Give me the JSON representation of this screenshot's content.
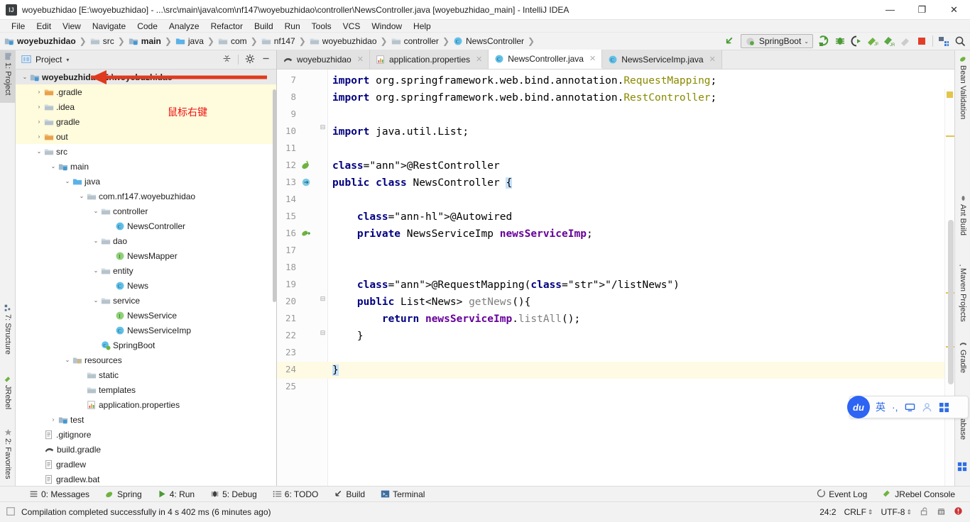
{
  "window": {
    "title": "woyebuzhidao [E:\\woyebuzhidao] - ...\\src\\main\\java\\com\\nf147\\woyebuzhidao\\controller\\NewsController.java [woyebuzhidao_main] - IntelliJ IDEA",
    "app_icon": "IJ",
    "minimize": "—",
    "maximize": "❐",
    "close": "✕"
  },
  "menubar": {
    "items": [
      {
        "label": "File"
      },
      {
        "label": "Edit"
      },
      {
        "label": "View"
      },
      {
        "label": "Navigate"
      },
      {
        "label": "Code"
      },
      {
        "label": "Analyze"
      },
      {
        "label": "Refactor"
      },
      {
        "label": "Build"
      },
      {
        "label": "Run"
      },
      {
        "label": "Tools"
      },
      {
        "label": "VCS"
      },
      {
        "label": "Window"
      },
      {
        "label": "Help"
      }
    ]
  },
  "breadcrumb": {
    "items": [
      {
        "label": "woyebuzhidao",
        "icon": "module-icon",
        "bold": true
      },
      {
        "label": "src",
        "icon": "folder-icon",
        "bold": false
      },
      {
        "label": "main",
        "icon": "module-source-icon",
        "bold": true
      },
      {
        "label": "java",
        "icon": "source-root-icon",
        "bold": false
      },
      {
        "label": "com",
        "icon": "package-icon",
        "bold": false
      },
      {
        "label": "nf147",
        "icon": "package-icon",
        "bold": false
      },
      {
        "label": "woyebuzhidao",
        "icon": "package-icon",
        "bold": false
      },
      {
        "label": "controller",
        "icon": "package-icon",
        "bold": false
      },
      {
        "label": "NewsController",
        "icon": "class-icon",
        "bold": false
      }
    ]
  },
  "toolbar": {
    "back_arrow": "back-arrow-icon",
    "run_config": "SpringBoot",
    "run_config_caret": "⌄",
    "buttons": [
      {
        "name": "run-button",
        "glyph": "▶"
      },
      {
        "name": "debug-button",
        "glyph": "🐞"
      },
      {
        "name": "run-with-coverage-button",
        "glyph": "▷"
      },
      {
        "name": "attach-profiler-button",
        "glyph": "◤"
      },
      {
        "name": "jrebel-debug-button",
        "glyph": "◥"
      },
      {
        "name": "jrebel-run-button",
        "glyph": "◣"
      },
      {
        "name": "stop-button",
        "glyph": "■"
      },
      {
        "name": "project-structure-button",
        "glyph": "▦"
      },
      {
        "name": "search-everywhere-button",
        "glyph": "🔍"
      }
    ]
  },
  "left_strip": {
    "tabs": [
      {
        "label": "1: Project",
        "selected": true
      },
      {
        "label": "7: Structure",
        "selected": false
      },
      {
        "label": "JRebel",
        "selected": false
      },
      {
        "label": "2: Favorites",
        "selected": false
      }
    ]
  },
  "right_strip": {
    "tabs": [
      {
        "label": "Bean Validation"
      },
      {
        "label": "Ant Build"
      },
      {
        "label": "Maven Projects"
      },
      {
        "label": "Gradle"
      },
      {
        "label": "Database"
      }
    ]
  },
  "project_panel": {
    "title": "Project",
    "caret": "▾",
    "collapse_all_icon": "collapse-all-icon",
    "settings_icon": "gear-icon",
    "hide_icon": "minimize-icon",
    "tree": [
      {
        "label": "woyebuzhidao  E:\\woyebuzhidao",
        "depth": 0,
        "twist": "⌄",
        "icon": "module-icon",
        "bold": true,
        "row": "selected"
      },
      {
        "label": ".gradle",
        "depth": 1,
        "twist": "›",
        "icon": "folder-orange-icon",
        "bold": false,
        "row": "yellow"
      },
      {
        "label": ".idea",
        "depth": 1,
        "twist": "›",
        "icon": "folder-icon",
        "bold": false,
        "row": "yellow"
      },
      {
        "label": "gradle",
        "depth": 1,
        "twist": "›",
        "icon": "folder-icon",
        "bold": false,
        "row": "yellow"
      },
      {
        "label": "out",
        "depth": 1,
        "twist": "›",
        "icon": "folder-orange-icon",
        "bold": false,
        "row": "yellow"
      },
      {
        "label": "src",
        "depth": 1,
        "twist": "⌄",
        "icon": "folder-icon",
        "bold": false,
        "row": "none"
      },
      {
        "label": "main",
        "depth": 2,
        "twist": "⌄",
        "icon": "module-source-icon",
        "bold": false,
        "row": "none"
      },
      {
        "label": "java",
        "depth": 3,
        "twist": "⌄",
        "icon": "source-root-icon",
        "bold": false,
        "row": "none"
      },
      {
        "label": "com.nf147.woyebuzhidao",
        "depth": 4,
        "twist": "⌄",
        "icon": "package-icon",
        "bold": false,
        "row": "none"
      },
      {
        "label": "controller",
        "depth": 5,
        "twist": "⌄",
        "icon": "package-icon",
        "bold": false,
        "row": "none"
      },
      {
        "label": "NewsController",
        "depth": 6,
        "twist": "",
        "icon": "class-icon",
        "bold": false,
        "row": "none"
      },
      {
        "label": "dao",
        "depth": 5,
        "twist": "⌄",
        "icon": "package-icon",
        "bold": false,
        "row": "none"
      },
      {
        "label": "NewsMapper",
        "depth": 6,
        "twist": "",
        "icon": "interface-icon",
        "bold": false,
        "row": "none"
      },
      {
        "label": "entity",
        "depth": 5,
        "twist": "⌄",
        "icon": "package-icon",
        "bold": false,
        "row": "none"
      },
      {
        "label": "News",
        "depth": 6,
        "twist": "",
        "icon": "class-icon",
        "bold": false,
        "row": "none"
      },
      {
        "label": "service",
        "depth": 5,
        "twist": "⌄",
        "icon": "package-icon",
        "bold": false,
        "row": "none"
      },
      {
        "label": "NewsService",
        "depth": 6,
        "twist": "",
        "icon": "interface-icon",
        "bold": false,
        "row": "none"
      },
      {
        "label": "NewsServiceImp",
        "depth": 6,
        "twist": "",
        "icon": "class-icon",
        "bold": false,
        "row": "none"
      },
      {
        "label": "SpringBoot",
        "depth": 5,
        "twist": "",
        "icon": "spring-class-icon",
        "bold": false,
        "row": "none"
      },
      {
        "label": "resources",
        "depth": 3,
        "twist": "⌄",
        "icon": "resources-root-icon",
        "bold": false,
        "row": "none"
      },
      {
        "label": "static",
        "depth": 4,
        "twist": "",
        "icon": "package-icon",
        "bold": false,
        "row": "none"
      },
      {
        "label": "templates",
        "depth": 4,
        "twist": "",
        "icon": "package-icon",
        "bold": false,
        "row": "none"
      },
      {
        "label": "application.properties",
        "depth": 4,
        "twist": "",
        "icon": "properties-file-icon",
        "bold": false,
        "row": "none"
      },
      {
        "label": "test",
        "depth": 2,
        "twist": "›",
        "icon": "module-test-icon",
        "bold": false,
        "row": "none"
      },
      {
        "label": ".gitignore",
        "depth": 1,
        "twist": "",
        "icon": "text-file-icon",
        "bold": false,
        "row": "none"
      },
      {
        "label": "build.gradle",
        "depth": 1,
        "twist": "",
        "icon": "gradle-file-icon",
        "bold": false,
        "row": "none"
      },
      {
        "label": "gradlew",
        "depth": 1,
        "twist": "",
        "icon": "text-file-icon",
        "bold": false,
        "row": "none"
      },
      {
        "label": "gradlew.bat",
        "depth": 1,
        "twist": "",
        "icon": "text-file-icon",
        "bold": false,
        "row": "none"
      }
    ]
  },
  "annotations": {
    "arrow_color": "#e03a1e",
    "note_text": "鼠标右键",
    "note_color": "#ee1111"
  },
  "editor": {
    "tabs": [
      {
        "label": "woyebuzhidao",
        "icon": "gradle-file-icon",
        "active": false,
        "close": "✕"
      },
      {
        "label": "application.properties",
        "icon": "properties-file-icon",
        "active": false,
        "close": "✕"
      },
      {
        "label": "NewsController.java",
        "icon": "class-icon",
        "active": true,
        "close": "✕"
      },
      {
        "label": "NewsServiceImp.java",
        "icon": "class-icon",
        "active": false,
        "close": "✕"
      }
    ],
    "first_line": 7,
    "last_line": 25,
    "caret_line": 24,
    "lines": [
      {
        "n": 7,
        "text": "import org.springframework.web.bind.annotation.RequestMapping;"
      },
      {
        "n": 8,
        "text": "import org.springframework.web.bind.annotation.RestController;"
      },
      {
        "n": 9,
        "text": ""
      },
      {
        "n": 10,
        "text": "import java.util.List;"
      },
      {
        "n": 11,
        "text": ""
      },
      {
        "n": 12,
        "text": "@RestController"
      },
      {
        "n": 13,
        "text": "public class NewsController {"
      },
      {
        "n": 14,
        "text": ""
      },
      {
        "n": 15,
        "text": "    @Autowired"
      },
      {
        "n": 16,
        "text": "    private NewsServiceImp newsServiceImp;"
      },
      {
        "n": 17,
        "text": ""
      },
      {
        "n": 18,
        "text": ""
      },
      {
        "n": 19,
        "text": "    @RequestMapping(\"/listNews\")"
      },
      {
        "n": 20,
        "text": "    public List<News> getNews(){"
      },
      {
        "n": 21,
        "text": "        return newsServiceImp.listAll();"
      },
      {
        "n": 22,
        "text": "    }"
      },
      {
        "n": 23,
        "text": ""
      },
      {
        "n": 24,
        "text": "}"
      },
      {
        "n": 25,
        "text": ""
      }
    ]
  },
  "bottom_tools": {
    "items": [
      {
        "label": "0: Messages",
        "mnemonic": "0",
        "icon": "messages-icon"
      },
      {
        "label": "Spring",
        "mnemonic": "",
        "icon": "spring-icon"
      },
      {
        "label": "4: Run",
        "mnemonic": "4",
        "icon": "run-icon"
      },
      {
        "label": "5: Debug",
        "mnemonic": "5",
        "icon": "debug-icon"
      },
      {
        "label": "6: TODO",
        "mnemonic": "6",
        "icon": "todo-icon"
      },
      {
        "label": "Build",
        "mnemonic": "",
        "icon": "build-icon"
      },
      {
        "label": "Terminal",
        "mnemonic": "",
        "icon": "terminal-icon"
      }
    ],
    "right_items": [
      {
        "label": "Event Log",
        "icon": "event-log-icon"
      },
      {
        "label": "JRebel Console",
        "icon": "jrebel-icon"
      }
    ]
  },
  "statusbar": {
    "message": "Compilation completed successfully in 4 s 402 ms (6 minutes ago)",
    "message_icon": "build-status-icon",
    "caret_position": "24:2",
    "line_separator": "CRLF",
    "encoding": "UTF-8",
    "lock_icon": "unlocked-icon",
    "inspection_icon": "inspections-icon",
    "error_icon": "error-icon",
    "separator_glyph": "⇕"
  },
  "ime": {
    "logo_text": "du",
    "items": [
      {
        "label": "英",
        "name": "ime-language-toggle"
      },
      {
        "label": "·,",
        "name": "ime-punctuation-toggle"
      },
      {
        "label": "▭",
        "name": "ime-soft-keyboard"
      },
      {
        "label": "👤",
        "name": "ime-user"
      },
      {
        "label": "▦",
        "name": "ime-toolbox"
      }
    ]
  }
}
